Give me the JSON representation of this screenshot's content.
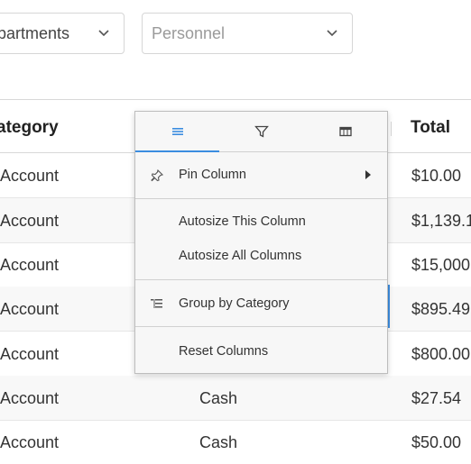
{
  "filters": {
    "departments": {
      "value": "epartments"
    },
    "personnel": {
      "placeholder": "Personnel"
    }
  },
  "grid": {
    "columns": {
      "category": "ategory",
      "total": "Total"
    },
    "rows": [
      {
        "category": "n Account",
        "method": "",
        "total": "$10.00"
      },
      {
        "category": "n Account",
        "method": "",
        "total": "$1,139.1"
      },
      {
        "category": "n Account",
        "method": "",
        "total": "$15,000."
      },
      {
        "category": "n Account",
        "method": "",
        "total": "$895.49"
      },
      {
        "category": "n Account",
        "method": "",
        "total": "$800.00"
      },
      {
        "category": "n Account",
        "method": "Cash",
        "total": "$27.54"
      },
      {
        "category": "n Account",
        "method": "Cash",
        "total": "$50.00"
      }
    ]
  },
  "column_menu": {
    "tabs": [
      {
        "icon": "menu-lines-icon",
        "active": true
      },
      {
        "icon": "filter-icon",
        "active": false
      },
      {
        "icon": "columns-icon",
        "active": false
      }
    ],
    "items": {
      "pin_column": "Pin Column",
      "autosize_this": "Autosize This Column",
      "autosize_all": "Autosize All Columns",
      "group_by": "Group by Category",
      "reset_columns": "Reset Columns"
    }
  },
  "colors": {
    "accent": "#3b8de0",
    "menu_bg": "#f7f7f7",
    "border": "#d6d6d6"
  }
}
